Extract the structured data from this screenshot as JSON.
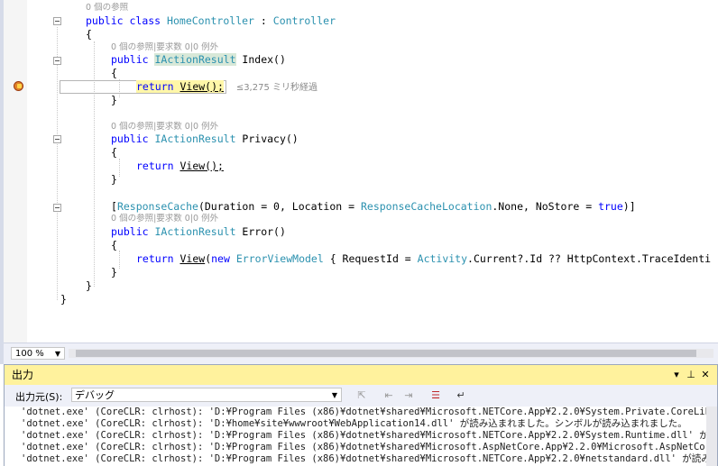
{
  "code": {
    "lens_class": "0 個の参照",
    "class_line": {
      "kw1": "public",
      "kw2": "class",
      "name": "HomeController",
      "sep": " : ",
      "base": "Controller"
    },
    "lens_index": "0 個の参照|要求数 0|0 例外",
    "index_sig": {
      "kw": "public",
      "type": "IActionResult",
      "name": " Index()"
    },
    "index_return": {
      "kw": "return",
      "call": "View();",
      "perf": "≤3,275 ミリ秒経過"
    },
    "lens_privacy": "0 個の参照|要求数 0|0 例外",
    "privacy_sig": {
      "kw": "public",
      "type": "IActionResult",
      "name": " Privacy()"
    },
    "privacy_return": {
      "kw": "return",
      "call": "View();"
    },
    "attr_line": {
      "open": "[",
      "attr": "ResponseCache",
      "p1": "(Duration = 0, Location = ",
      "enum": "ResponseCacheLocation",
      "p2": ".None, NoStore = ",
      "bool": "true",
      "close": ")]"
    },
    "lens_error": "0 個の参照|要求数 0|0 例外",
    "error_sig": {
      "kw": "public",
      "type": "IActionResult",
      "name": " Error()"
    },
    "error_return": {
      "kw": "return",
      "call": "View",
      "p1": "(",
      "kw2": "new",
      "type": "ErrorViewModel",
      "p2": " { RequestId = ",
      "type2": "Activity",
      "p3": ".Current?.Id ?? HttpContext.TraceIdenti"
    },
    "brace_open": "{",
    "brace_close": "}"
  },
  "zoom": {
    "value": "100 %"
  },
  "output_panel": {
    "title": "出力",
    "source_label": "出力元(S):",
    "source_value": "デバッグ",
    "lines": [
      "'dotnet.exe' (CoreCLR: clrhost): 'D:¥Program Files (x86)¥dotnet¥shared¥Microsoft.NETCore.App¥2.2.0¥System.Private.CoreLib.dll",
      "'dotnet.exe' (CoreCLR: clrhost): 'D:¥home¥site¥wwwroot¥WebApplication14.dll' が読み込まれました。シンボルが読み込まれました。",
      "'dotnet.exe' (CoreCLR: clrhost): 'D:¥Program Files (x86)¥dotnet¥shared¥Microsoft.NETCore.App¥2.2.0¥System.Runtime.dll' が読み",
      "'dotnet.exe' (CoreCLR: clrhost): 'D:¥Program Files (x86)¥dotnet¥shared¥Microsoft.AspNetCore.App¥2.2.0¥Microsoft.AspNetCore.Ho",
      "'dotnet.exe' (CoreCLR: clrhost): 'D:¥Program Files (x86)¥dotnet¥shared¥Microsoft.NETCore.App¥2.2.0¥netstandard.dll' が読み込"
    ]
  },
  "colors": {
    "keyword": "#0000ff",
    "type": "#2b91af",
    "title_bar": "#fff29d"
  }
}
